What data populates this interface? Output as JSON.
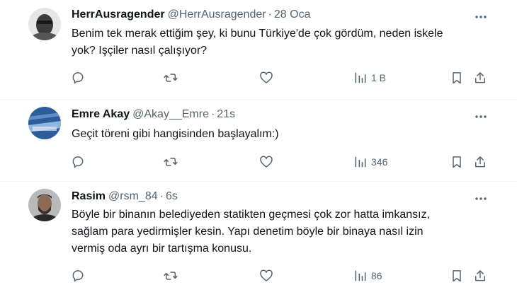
{
  "tweets": [
    {
      "name": "HerrAusragender",
      "handle": "@HerrAusragender",
      "separator": "·",
      "time": "28 Oca",
      "lines": [
        "Benim tek merak ettiğim şey, ki bunu Türkiye'de çok gördüm, neden iskele",
        "yok? Işçiler nasıl çalışıyor?"
      ],
      "views": "1 B"
    },
    {
      "name": "Emre Akay",
      "handle": "@Akay__Emre",
      "separator": "·",
      "time": "21s",
      "lines": [
        "Geçit töreni gibi hangisinden başlayalım:)"
      ],
      "views": "346"
    },
    {
      "name": "Rasim",
      "handle": "@rsm_84",
      "separator": "·",
      "time": "6s",
      "lines": [
        "Böyle bir binanın belediyeden statikten geçmesi çok zor hatta imkansız,",
        "sağlam para yedirmişler kesin. Yapı denetim böyle bir binaya nasıl izin",
        "vermiş oda ayrı bir tartışma konusu."
      ],
      "views": "86"
    }
  ],
  "icons": {
    "reply": "reply-icon",
    "retweet": "retweet-icon",
    "like": "like-icon",
    "views": "views-icon",
    "bookmark": "bookmark-icon",
    "share": "share-icon",
    "more": "more-icon"
  },
  "colors": {
    "text": "#0f1419",
    "secondary": "#536471",
    "divider": "#eff3f4"
  }
}
